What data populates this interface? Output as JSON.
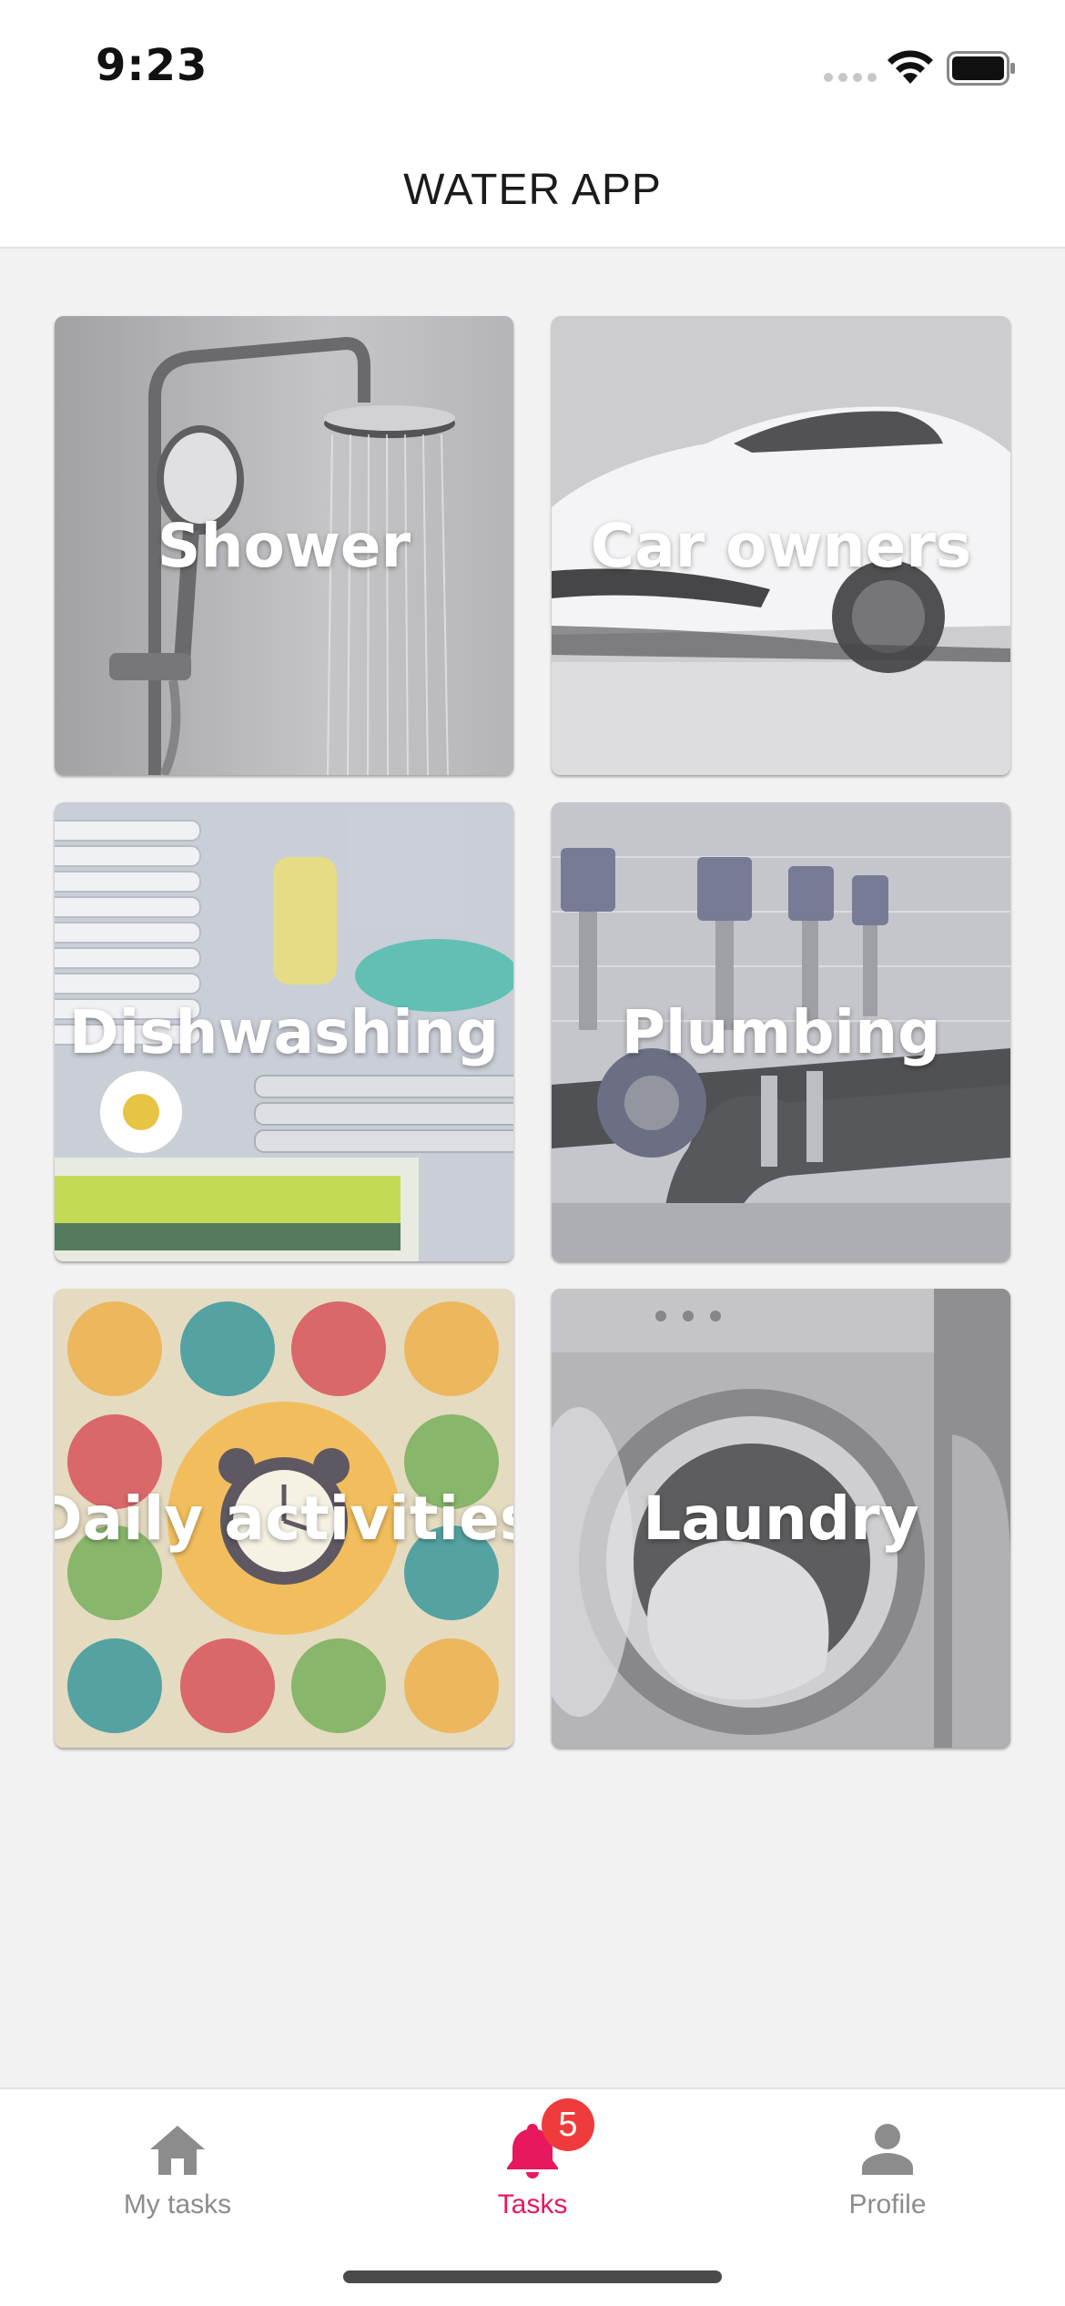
{
  "status_bar": {
    "time": "9:23"
  },
  "header": {
    "title": "WATER APP"
  },
  "categories": [
    {
      "label": "Shower"
    },
    {
      "label": "Car owners"
    },
    {
      "label": "Dishwashing"
    },
    {
      "label": "Plumbing"
    },
    {
      "label": "Daily activities"
    },
    {
      "label": "Laundry"
    }
  ],
  "tab_bar": {
    "tabs": [
      {
        "label": "My tasks",
        "icon": "home-icon"
      },
      {
        "label": "Tasks",
        "icon": "bell-icon",
        "active": true
      },
      {
        "label": "Profile",
        "icon": "person-icon"
      }
    ],
    "badge_count": "5",
    "active_color": "#e8185e",
    "inactive_color": "#8c8c8c"
  }
}
